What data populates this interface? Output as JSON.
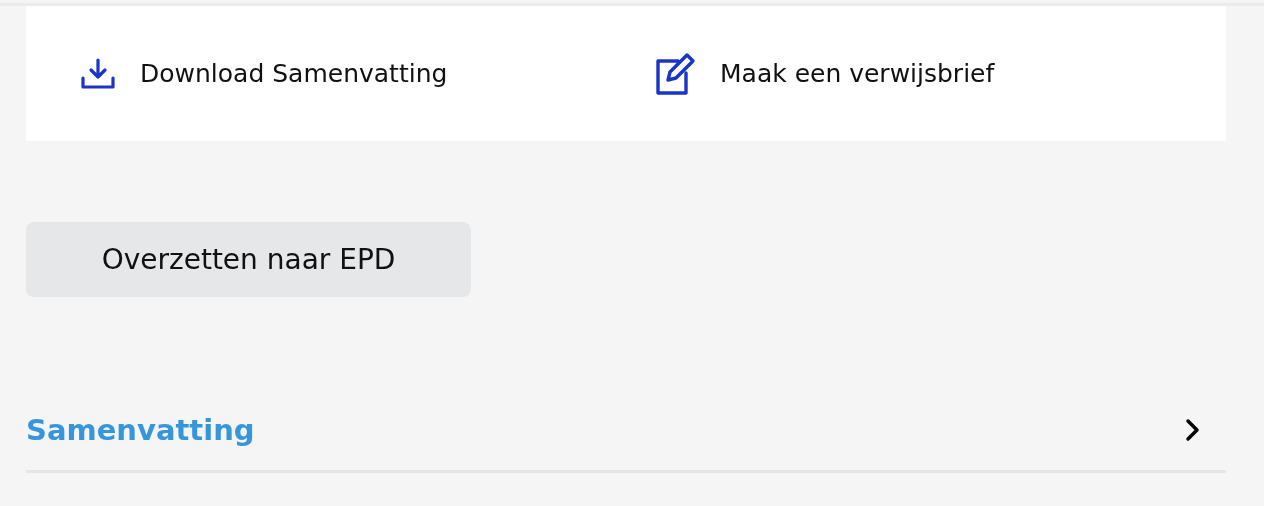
{
  "actions": [
    {
      "kind": "download",
      "label": "Download Samenvatting"
    },
    {
      "kind": "edit",
      "label": "Maak een verwijsbrief"
    }
  ],
  "transfer_button": {
    "label": "Overzetten naar EPD"
  },
  "sections": [
    {
      "title": "Samenvatting",
      "expanded": false
    }
  ]
}
